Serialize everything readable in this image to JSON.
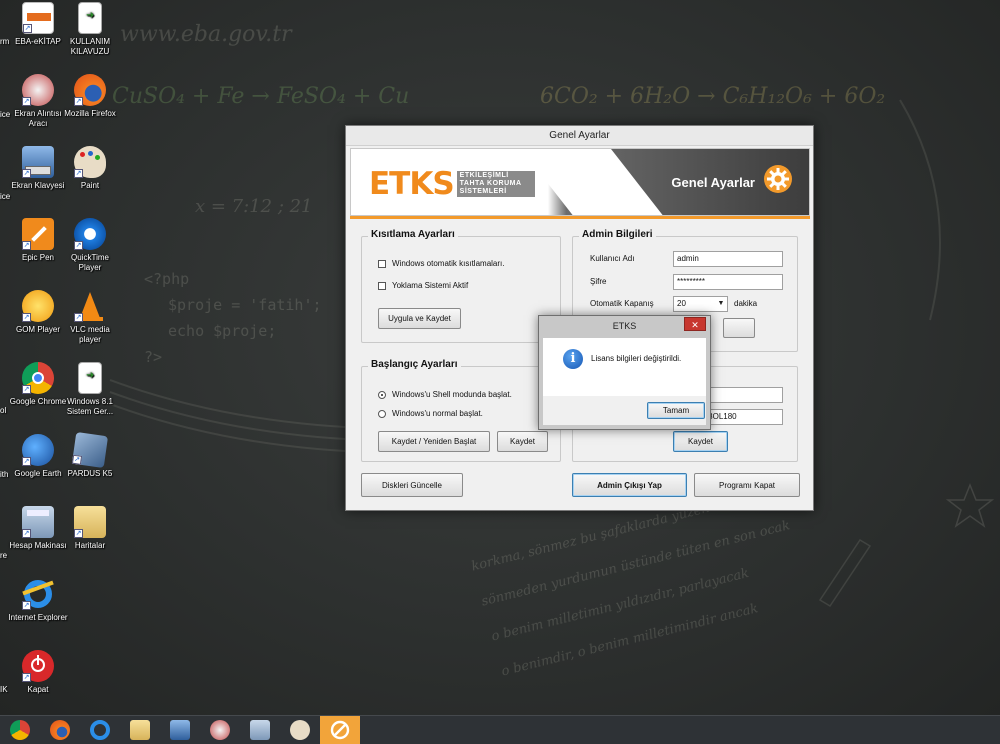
{
  "desktop": {
    "icons": [
      {
        "label": "EBA-eKİTAP"
      },
      {
        "label": "KULLANIM KILAVUZU"
      },
      {
        "label": "Ekran Alıntısı Aracı"
      },
      {
        "label": "Mozilla Firefox"
      },
      {
        "label": "Ekran Klavyesi"
      },
      {
        "label": "Paint"
      },
      {
        "label": "Epic Pen"
      },
      {
        "label": "QuickTime Player"
      },
      {
        "label": "GOM Player"
      },
      {
        "label": "VLC media player"
      },
      {
        "label": "Google Chrome"
      },
      {
        "label": "Windows 8.1 Sistem Ger..."
      },
      {
        "label": "Google Earth"
      },
      {
        "label": "PARDUS K5"
      },
      {
        "label": "Hesap Makinası"
      },
      {
        "label": "Haritalar"
      },
      {
        "label": "Internet Explorer"
      },
      {
        "label": "Kapat"
      }
    ],
    "cut_labels": [
      "rm",
      "ice",
      "ice",
      "ol",
      "ith",
      "re",
      "IK"
    ]
  },
  "main_window": {
    "title": "Genel Ayarlar",
    "banner": {
      "logo_word": "ETKS",
      "logo_sub_1": "ETKİLEŞİMLİ",
      "logo_sub_2": "TAHTA KORUMA",
      "logo_sub_3": "SİSTEMLERİ",
      "title": "Genel Ayarlar"
    },
    "restrictions": {
      "title": "Kısıtlama Ayarları",
      "opt_windows": "Windows otomatik kısıtlamaları.",
      "opt_attendance": "Yoklama Sistemi Aktif",
      "apply_btn": "Uygula ve Kaydet"
    },
    "startup": {
      "title": "Başlangıç Ayarları",
      "opt_shell": "Windows'u Shell modunda başlat.",
      "opt_normal": "Windows'u normal başlat.",
      "save_restart_btn": "Kaydet / Yeniden Başlat",
      "save_btn": "Kaydet"
    },
    "admin": {
      "title": "Admin Bilgileri",
      "username_label": "Kullanıcı Adı",
      "username_value": "admin",
      "password_label": "Şifre",
      "password_value": "*********",
      "autoclose_label": "Otomatik Kapanış",
      "autoclose_value": "20",
      "minutes_label": "dakika"
    },
    "license": {
      "key_value": "09053258OL180",
      "save_btn": "Kaydet"
    },
    "bottom": {
      "update_disks_btn": "Diskleri Güncelle",
      "admin_logout_btn": "Admin Çıkışı Yap",
      "close_program_btn": "Programı Kapat"
    }
  },
  "message_box": {
    "title": "ETKS",
    "close_glyph": "✕",
    "icon_glyph": "i",
    "message": "Lisans bilgileri değiştirildi.",
    "ok_btn": "Tamam"
  },
  "taskbar": {
    "items": [
      "chrome",
      "firefox",
      "internet-explorer",
      "file-explorer",
      "on-screen-keyboard",
      "snipping-tool",
      "calculator",
      "paint",
      "etks"
    ]
  },
  "chalkboard": {
    "url": "www.eba.gov.tr",
    "formula_left": "CuSO₄ + Fe → FeSO₄ + Cu",
    "formula_right": "6CO₂ + 6H₂O → C₆H₁₂O₆ + 6O₂",
    "php_1": "<?php",
    "php_2": "$proje = 'fatih';",
    "php_3": "echo $proje;",
    "php_4": "?>",
    "math": "x = 7:12 ; 21",
    "poem_1": "korkma, sönmez bu şafaklarda yüzen al sancak",
    "poem_2": "sönmeden yurdumun üstünde tüten en son ocak",
    "poem_3": "o benim milletimin yıldızıdır, parlayacak",
    "poem_4": "o benimdir, o benim milletimindir ancak"
  }
}
